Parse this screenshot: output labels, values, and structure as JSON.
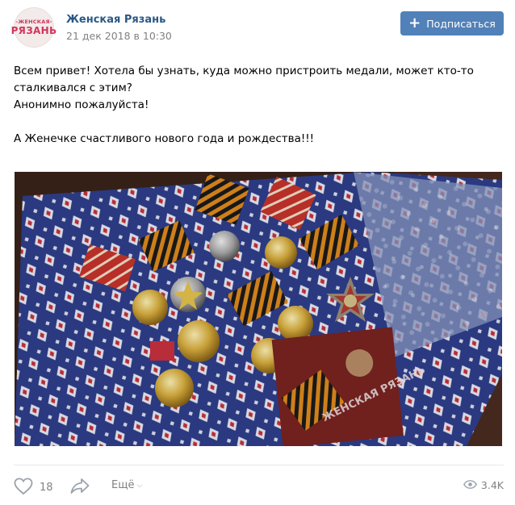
{
  "post": {
    "group_name": "Женская Рязань",
    "avatar_line1": "-ЖЕНСКАЯ-",
    "avatar_line2": "РЯЗАНЬ",
    "date": "21 дек 2018 в 10:30",
    "subscribe_label": "Подписаться",
    "text_lines": [
      "Всем привет! Хотела бы узнать, куда можно пристроить медали, может кто-то",
      "сталкивался с этим?",
      "Анонимно пожалуйста!",
      "А Женечке счастливого нового года и рождества!!!"
    ],
    "photo_booklet_text": "ЖЕНСКАЯ РЯЗАНЬ"
  },
  "actions": {
    "like_count": "18",
    "more_label": "Ещё",
    "views_count": "3.4K"
  },
  "colors": {
    "accent": "#5181b8",
    "link": "#2a5885",
    "muted": "#828282",
    "brand": "#d1365a"
  },
  "icons": [
    "heart-icon",
    "share-icon",
    "chevron-down-icon",
    "eye-icon",
    "plus-icon"
  ]
}
